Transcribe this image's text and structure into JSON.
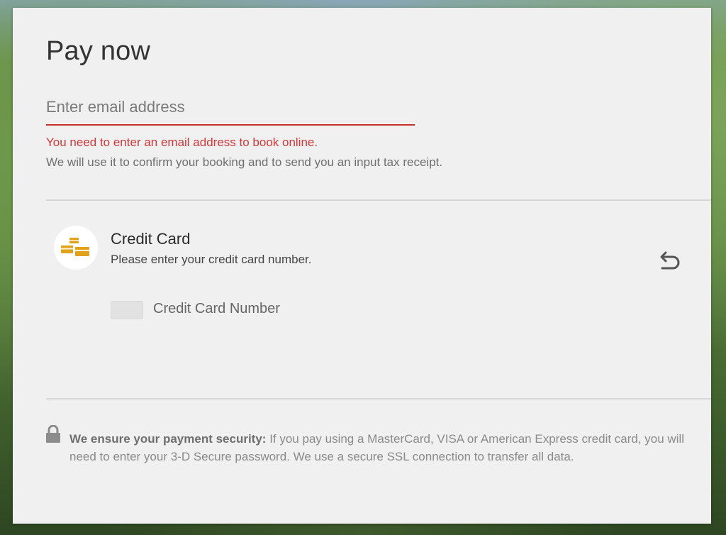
{
  "header": {
    "title": "Pay now"
  },
  "email": {
    "placeholder": "Enter email address",
    "value": "",
    "error": "You need to enter an email address to book online.",
    "help": "We will use it to confirm your booking and to send you an input tax receipt."
  },
  "payment": {
    "method_title": "Credit Card",
    "method_subtitle": "Please enter your credit card number.",
    "card_number_label": "Credit Card Number",
    "icon": "credit-cards-icon",
    "undo_icon": "undo-icon"
  },
  "security": {
    "icon": "lock-icon",
    "heading": "We ensure your payment security:",
    "body": "If you pay using a MasterCard, VISA or American Express credit card, you will need to enter your 3-D Secure password. We use a secure SSL connection to transfer all data."
  },
  "colors": {
    "error": "#d1373a",
    "underline": "#c8302f",
    "card_icon": "#e0a21a",
    "panel": "#f0f0f0"
  }
}
